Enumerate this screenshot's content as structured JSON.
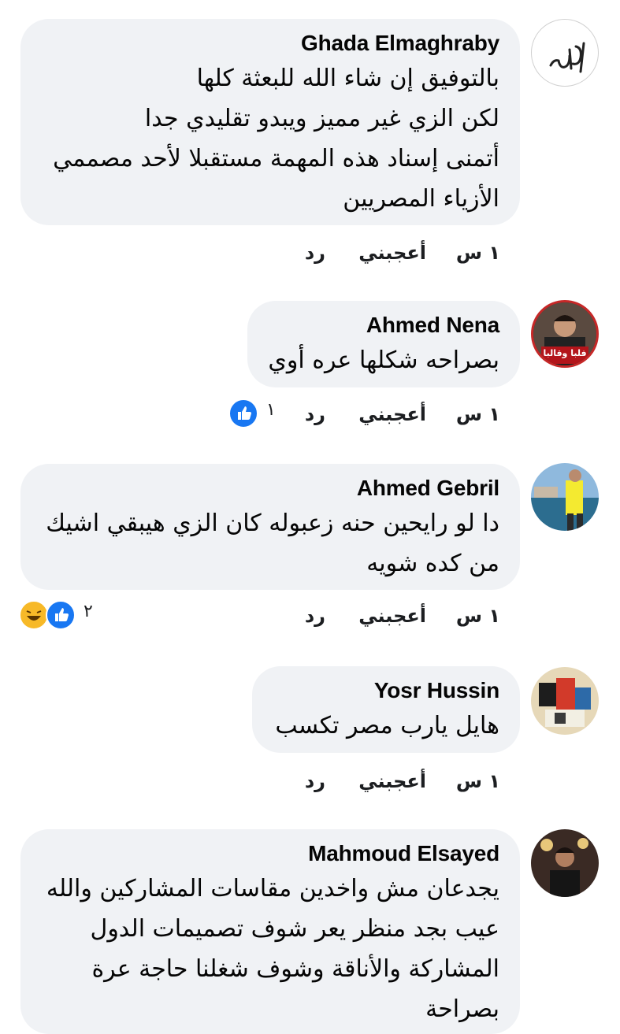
{
  "comments": [
    {
      "author": "Ghada Elmaghraby",
      "avatar_text": "يارب",
      "text": "بالتوفيق إن شاء الله للبعثة كلها\nلكن الزي غير مميز ويبدو تقليدي جدا\nأتمنى إسناد هذه المهمة مستقبلا لأحد مصممي\nالأزياء المصريين",
      "time": "١ س",
      "like_label": "أعجبني",
      "reply_label": "رد"
    },
    {
      "author": "Ahmed Nena",
      "avatar_text": "فلبا وقالبا",
      "text": "بصراحه شكلها عره أوي",
      "time": "١ س",
      "like_label": "أعجبني",
      "reply_label": "رد",
      "reaction_count": "١",
      "reactions": [
        "like"
      ]
    },
    {
      "author": "Ahmed Gebril",
      "text": "دا لو رايحين حنه زعبوله كان الزي هيبقي اشيك\nمن كده شويه",
      "time": "١ س",
      "like_label": "أعجبني",
      "reply_label": "رد",
      "reaction_count": "٢",
      "reactions": [
        "like",
        "haha"
      ]
    },
    {
      "author": "Yosr Hussin",
      "text": "هايل يارب مصر تكسب",
      "time": "١ س",
      "like_label": "أعجبني",
      "reply_label": "رد"
    },
    {
      "author": "Mahmoud Elsayed",
      "text": "يجدعان مش واخدين مقاسات المشاركين والله\nعيب بجد منظر يعر شوف تصميمات الدول\nالمشاركة والأناقة وشوف شغلنا حاجة عرة\nبصراحة"
    }
  ],
  "colors": {
    "bubble": "#f0f2f5",
    "like_blue": "#1877f2",
    "haha_yellow": "#f7b928",
    "text": "#050505"
  }
}
